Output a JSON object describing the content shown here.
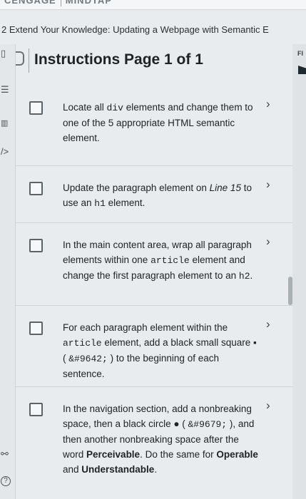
{
  "brand": {
    "left": "CENGAGE",
    "right": "MINDTAP"
  },
  "breadcrumb": "2 Extend Your Knowledge: Updating a Webpage with Semantic E",
  "header": {
    "title": "Instructions Page 1 of 1"
  },
  "right_rail": {
    "label": "FI"
  },
  "tasks": [
    {
      "t1": "Locate all ",
      "c1": "div",
      "t2": " elements and change them to one of the 5 appropriate HTML semantic element."
    },
    {
      "t1": "Update the paragraph element on ",
      "i1": "Line 15",
      "t2": " to use an ",
      "c1": "h1",
      "t3": " element."
    },
    {
      "t1": "In the main content area, wrap all paragraph elements within one ",
      "c1": "article",
      "t2": " element and change the first paragraph element to an ",
      "c2": "h2",
      "t3": "."
    },
    {
      "t1": "For each paragraph element within the ",
      "c1": "article",
      "t2": " element, add a black small square ",
      "g1": "▪",
      "t3": " ( ",
      "c2": "&#9642;",
      "t4": " ) to the beginning of each sentence."
    },
    {
      "t1": "In the navigation section, add a nonbreaking space, then a black circle ",
      "g1": "●",
      "t2": " ( ",
      "c1": "&#9679;",
      "t3": " ), and then another nonbreaking space after the word ",
      "b1": "Perceivable",
      "t4": ". Do the same for ",
      "b2": "Operable",
      "t5": " and ",
      "b3": "Understandable",
      "t6": "."
    }
  ]
}
